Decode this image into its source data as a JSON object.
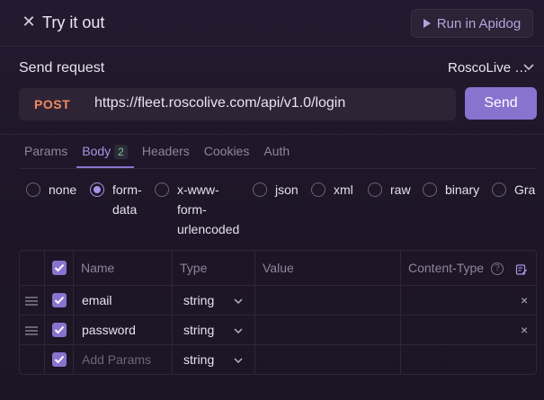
{
  "header": {
    "title": "Try it out",
    "run_label": "Run in Apidog"
  },
  "request": {
    "section_label": "Send request",
    "environment": "RoscoLive …",
    "method": "POST",
    "url": "https://fleet.roscolive.com/api/v1.0/login",
    "send_label": "Send"
  },
  "tabs": [
    {
      "label": "Params"
    },
    {
      "label": "Body",
      "badge": "2",
      "active": true
    },
    {
      "label": "Headers"
    },
    {
      "label": "Cookies"
    },
    {
      "label": "Auth"
    }
  ],
  "body_types": [
    {
      "label": "none"
    },
    {
      "line1": "form-",
      "line2": "data",
      "selected": true
    },
    {
      "line1": "x-www-",
      "line2": "form-",
      "line3": "urlencoded"
    },
    {
      "label": "json"
    },
    {
      "label": "xml"
    },
    {
      "label": "raw"
    },
    {
      "label": "binary"
    },
    {
      "label": "Gra"
    }
  ],
  "table": {
    "columns": {
      "name": "Name",
      "type": "Type",
      "value": "Value",
      "content_type": "Content-Type",
      "help": "?"
    },
    "rows": [
      {
        "name": "email",
        "type": "string",
        "value": ""
      },
      {
        "name": "password",
        "type": "string",
        "value": ""
      }
    ],
    "add_row": {
      "placeholder": "Add Params",
      "type": "string"
    },
    "remove_symbol": "×"
  },
  "colors": {
    "accent": "#8a73cf",
    "method_post": "#f08a5d",
    "badge_green": "#6fcf97"
  },
  "icons": [
    "close-icon",
    "play-icon",
    "chevron-down-icon",
    "drag-handle-icon",
    "checkbox-icon",
    "help-icon",
    "bulk-edit-icon",
    "remove-icon"
  ]
}
